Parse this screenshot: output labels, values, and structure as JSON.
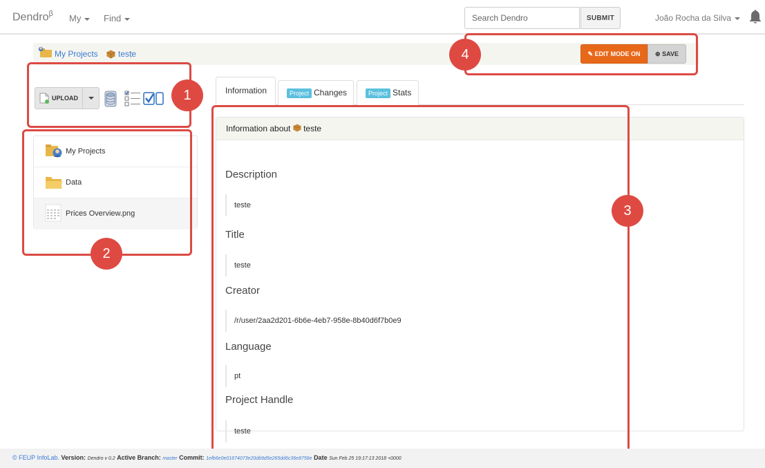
{
  "navbar": {
    "brand": "Dendro",
    "brand_sup": "β",
    "my_menu": "My",
    "find_menu": "Find",
    "search_placeholder": "Search Dendro",
    "submit_label": "SUBMIT",
    "user_name": "João Rocha da Silva"
  },
  "breadcrumb": {
    "items": [
      "My Projects",
      "teste"
    ],
    "separator": "〉"
  },
  "edit_bar": {
    "edit_mode_label": "EDIT MODE ON",
    "save_label": "SAVE",
    "edit_color": "#e8681a"
  },
  "toolbar": {
    "upload_label": "UPLOAD"
  },
  "file_list": [
    {
      "name": "My Projects",
      "icon": "project-folder-icon"
    },
    {
      "name": "Data",
      "icon": "folder-icon"
    },
    {
      "name": "Prices Overview.png",
      "icon": "image-file-icon"
    }
  ],
  "tabs": [
    {
      "label": "Information",
      "badge": ""
    },
    {
      "label": "Changes",
      "badge": "Project"
    },
    {
      "label": "Stats",
      "badge": "Project"
    }
  ],
  "panel": {
    "heading_prefix": "Information about",
    "heading_name": "teste",
    "fields": [
      {
        "label": "Description",
        "value": "teste"
      },
      {
        "label": "Title",
        "value": "teste"
      },
      {
        "label": "Creator",
        "value": "/r/user/2aa2d201-6b6e-4eb7-958e-8b40d6f7b0e9"
      },
      {
        "label": "Language",
        "value": "pt"
      },
      {
        "label": "Project Handle",
        "value": "teste"
      }
    ]
  },
  "annotations": [
    "1",
    "2",
    "3",
    "4"
  ],
  "footer": {
    "copyright": "© FEUP InfoLab.",
    "version_label": "Version:",
    "version_value": "Dendro v 0.2",
    "branch_label": "Active Branch:",
    "branch_value": "master",
    "commit_label": "Commit:",
    "commit_value": "1efb6e0e01674073e20db9d5e265dd6c36e8756e",
    "date_label": "Date",
    "date_value": "Sun Feb 25 19:17:13 2018 +0000"
  },
  "colors": {
    "accent_blue": "#3a7bd5",
    "annotation_red": "#db4a43",
    "badge": "#5bc0de"
  }
}
